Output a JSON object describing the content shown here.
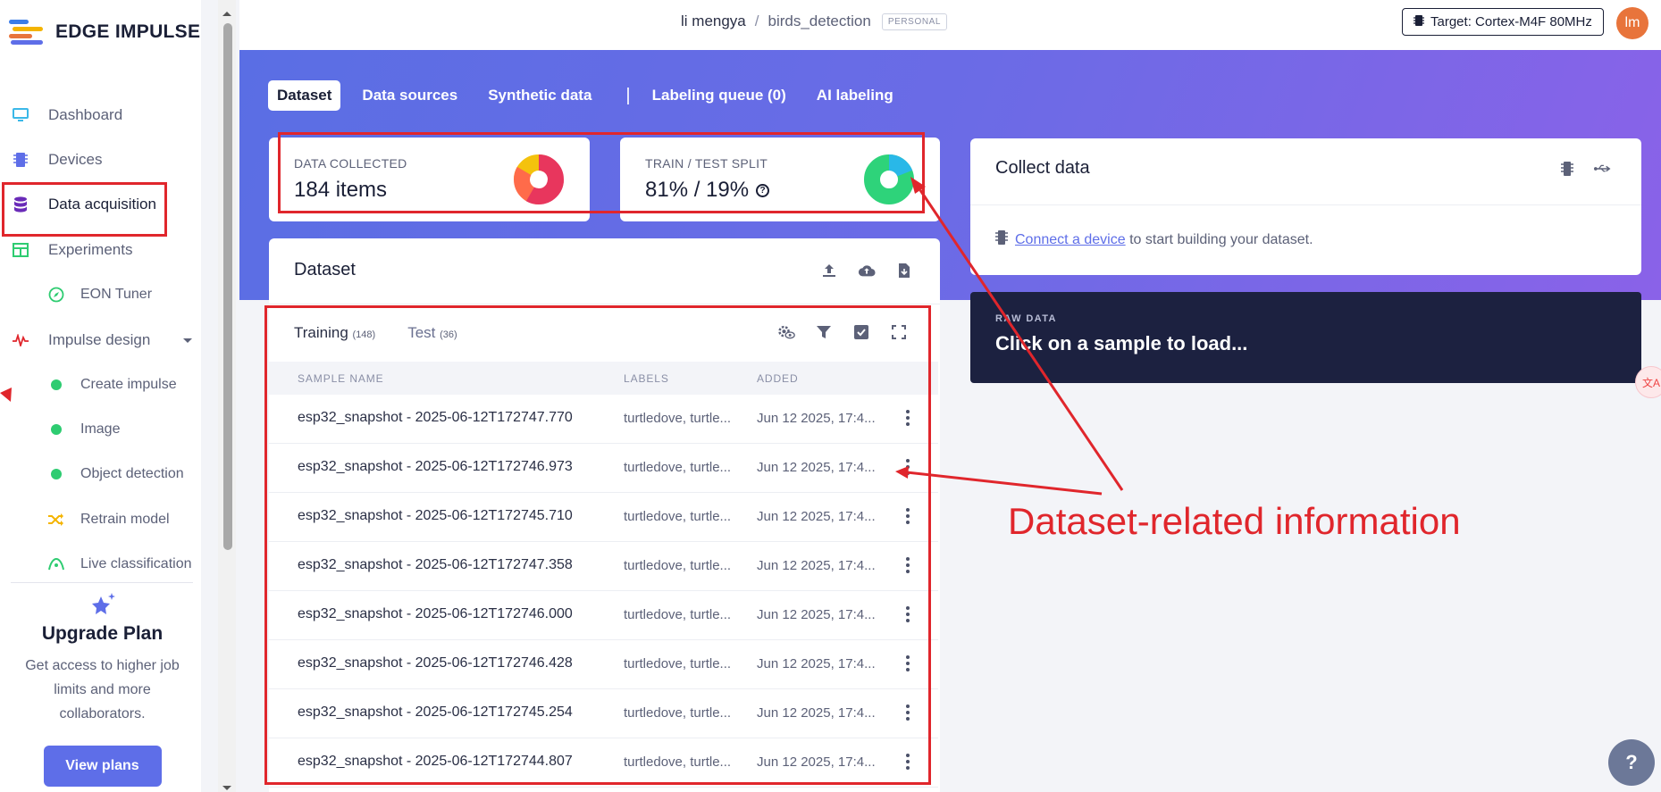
{
  "app": {
    "name": "EDGE IMPULSE"
  },
  "sidebar": {
    "items": [
      {
        "label": "Dashboard"
      },
      {
        "label": "Devices"
      },
      {
        "label": "Data acquisition"
      },
      {
        "label": "Experiments"
      },
      {
        "label": "EON Tuner"
      },
      {
        "label": "Impulse design"
      },
      {
        "label": "Create impulse"
      },
      {
        "label": "Image"
      },
      {
        "label": "Object detection"
      },
      {
        "label": "Retrain model"
      },
      {
        "label": "Live classification"
      }
    ],
    "upgrade": {
      "title": "Upgrade Plan",
      "text": "Get access to higher job limits and more collaborators.",
      "button": "View plans"
    }
  },
  "header": {
    "user": "li mengya",
    "separator": "/",
    "project": "birds_detection",
    "badge": "PERSONAL",
    "target": "Target: Cortex-M4F 80MHz",
    "avatar": "lm"
  },
  "tabs": [
    {
      "label": "Dataset"
    },
    {
      "label": "Data sources"
    },
    {
      "label": "Synthetic data"
    },
    {
      "label": "Labeling queue (0)"
    },
    {
      "label": "AI labeling"
    }
  ],
  "tab_divider": "|",
  "stats": {
    "collected": {
      "label": "DATA COLLECTED",
      "value": "184 items"
    },
    "split": {
      "label": "TRAIN / TEST SPLIT",
      "value": "81% / 19%",
      "train_pct": 81,
      "test_pct": 19
    }
  },
  "dataset": {
    "title": "Dataset",
    "training_label": "Training",
    "training_count": "(148)",
    "test_label": "Test",
    "test_count": "(36)",
    "columns": [
      "SAMPLE NAME",
      "LABELS",
      "ADDED"
    ],
    "rows": [
      {
        "name": "esp32_snapshot - 2025-06-12T172747.770",
        "labels": "turtledove, turtle...",
        "added": "Jun 12 2025, 17:4..."
      },
      {
        "name": "esp32_snapshot - 2025-06-12T172746.973",
        "labels": "turtledove, turtle...",
        "added": "Jun 12 2025, 17:4..."
      },
      {
        "name": "esp32_snapshot - 2025-06-12T172745.710",
        "labels": "turtledove, turtle...",
        "added": "Jun 12 2025, 17:4..."
      },
      {
        "name": "esp32_snapshot - 2025-06-12T172747.358",
        "labels": "turtledove, turtle...",
        "added": "Jun 12 2025, 17:4..."
      },
      {
        "name": "esp32_snapshot - 2025-06-12T172746.000",
        "labels": "turtledove, turtle...",
        "added": "Jun 12 2025, 17:4..."
      },
      {
        "name": "esp32_snapshot - 2025-06-12T172746.428",
        "labels": "turtledove, turtle...",
        "added": "Jun 12 2025, 17:4..."
      },
      {
        "name": "esp32_snapshot - 2025-06-12T172745.254",
        "labels": "turtledove, turtle...",
        "added": "Jun 12 2025, 17:4..."
      },
      {
        "name": "esp32_snapshot - 2025-06-12T172744.807",
        "labels": "turtledove, turtle...",
        "added": "Jun 12 2025, 17:4..."
      }
    ]
  },
  "collect": {
    "title": "Collect data",
    "link": "Connect a device",
    "text": " to start building your dataset."
  },
  "raw_data": {
    "label": "RAW DATA",
    "text": "Click on a sample to load..."
  },
  "annotation": {
    "text": "Dataset-related information",
    "color": "#e0262c"
  },
  "colors": {
    "accent": "#5e6ee8",
    "dark": "#1c2140",
    "annotation_red": "#e0262c"
  }
}
